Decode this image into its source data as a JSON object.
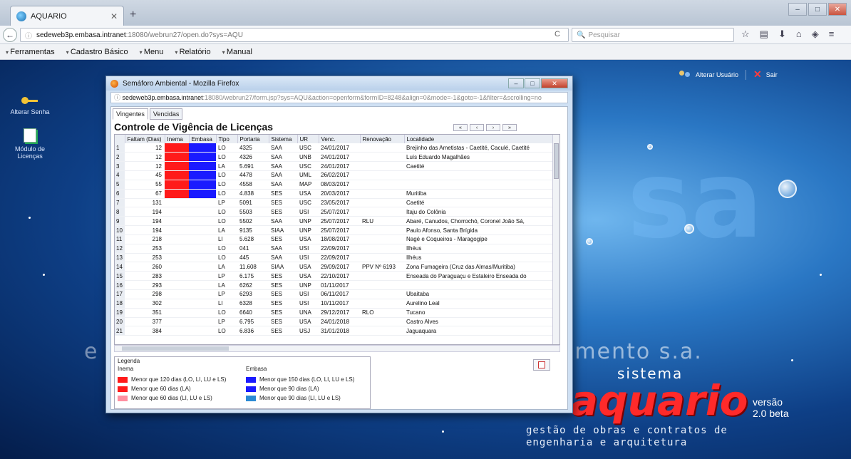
{
  "browser": {
    "tab_title": "AQUARIO",
    "url_host": "sedeweb3p.embasa.intranet",
    "url_rest": ":18080/webrun27/open.do?sys=AQU",
    "search_placeholder": "Pesquisar"
  },
  "menubar": [
    "Ferramentas",
    "Cadastro Básico",
    "Menu",
    "Relatório",
    "Manual"
  ],
  "desktop": {
    "icons": [
      {
        "label": "Alterar Senha",
        "icon": "key-icon"
      },
      {
        "label": "Módulo de Licenças",
        "icon": "document-icon"
      }
    ],
    "user_actions": {
      "change_user": "Alterar Usuário",
      "logout": "Sair"
    },
    "watermark_left": "e",
    "watermark_right": "amento s.a.",
    "brand": {
      "sistema": "sistema",
      "name": "aquario",
      "versao": "versão",
      "version": "2.0 beta",
      "tagline_1": "gestão de obras e contratos de",
      "tagline_2": "engenharia e arquitetura"
    }
  },
  "popup": {
    "window_title": "Semáforo Ambiental - Mozilla Firefox",
    "url_host": "sedeweb3p.embasa.intranet",
    "url_rest": ":18080/webrun27/form.jsp?sys=AQU&action=openform&formID=8248&align=0&mode=-1&goto=-1&filter=&scrolling=no",
    "tabs": [
      "Vingentes",
      "Vencidas"
    ],
    "title": "Controle de Vigência de Licenças",
    "pager": [
      "«",
      "‹",
      "›",
      "»"
    ],
    "columns": [
      "",
      "Faltam (Dias)",
      "Inema",
      "Embasa",
      "Tipo",
      "Portaria",
      "Sistema",
      "UR",
      "Venc.",
      "Renovação",
      "Localidade"
    ],
    "rows": [
      [
        "1",
        "12",
        "",
        "",
        "LO",
        "4325",
        "SAA",
        "USC",
        "24/01/2017",
        "",
        "Brejinho das Ametistas - Caetité, Caculé, Caetité"
      ],
      [
        "2",
        "12",
        "",
        "",
        "LO",
        "4326",
        "SAA",
        "UNB",
        "24/01/2017",
        "",
        "Luís Eduardo Magalhães"
      ],
      [
        "3",
        "12",
        "",
        "",
        "LA",
        "5.691",
        "SAA",
        "USC",
        "24/01/2017",
        "",
        "Caetité"
      ],
      [
        "4",
        "45",
        "",
        "",
        "LO",
        "4478",
        "SAA",
        "UML",
        "26/02/2017",
        "",
        ""
      ],
      [
        "5",
        "55",
        "",
        "",
        "LO",
        "4558",
        "SAA",
        "MAP",
        "08/03/2017",
        "",
        ""
      ],
      [
        "6",
        "67",
        "",
        "",
        "LO",
        "4.838",
        "SES",
        "USA",
        "20/03/2017",
        "",
        "Muritiba"
      ],
      [
        "7",
        "131",
        "",
        "",
        "LP",
        "5091",
        "SES",
        "USC",
        "23/05/2017",
        "",
        "Caetité"
      ],
      [
        "8",
        "194",
        "",
        "",
        "LO",
        "5503",
        "SES",
        "USI",
        "25/07/2017",
        "",
        "Itaju do Colônia"
      ],
      [
        "9",
        "194",
        "",
        "",
        "LO",
        "5502",
        "SAA",
        "UNP",
        "25/07/2017",
        "RLU",
        "Abaré, Canudos, Chorrochó, Coronel João Sá,"
      ],
      [
        "10",
        "194",
        "",
        "",
        "LA",
        "9135",
        "SIAA",
        "UNP",
        "25/07/2017",
        "",
        "Paulo Afonso, Santa Brígida"
      ],
      [
        "11",
        "218",
        "",
        "",
        "LI",
        "5.628",
        "SES",
        "USA",
        "18/08/2017",
        "",
        "Nagé e Coqueiros - Maragogipe"
      ],
      [
        "12",
        "253",
        "",
        "",
        "LO",
        "041",
        "SAA",
        "USI",
        "22/09/2017",
        "",
        "Ilhéus"
      ],
      [
        "13",
        "253",
        "",
        "",
        "LO",
        "445",
        "SAA",
        "USI",
        "22/09/2017",
        "",
        "Ilhéus"
      ],
      [
        "14",
        "260",
        "",
        "",
        "LA",
        "11.608",
        "SIAA",
        "USA",
        "29/09/2017",
        "PPV Nº 6193",
        "Zona Fumageira (Cruz das Almas/Muritiba)"
      ],
      [
        "15",
        "283",
        "",
        "",
        "LP",
        "6.175",
        "SES",
        "USA",
        "22/10/2017",
        "",
        "Enseada do Paraguaçu e Estaleiro Enseada do"
      ],
      [
        "16",
        "293",
        "",
        "",
        "LA",
        "6262",
        "SES",
        "UNP",
        "01/11/2017",
        "",
        ""
      ],
      [
        "17",
        "298",
        "",
        "",
        "LP",
        "6293",
        "SES",
        "USI",
        "06/11/2017",
        "",
        "Ubaitaba"
      ],
      [
        "18",
        "302",
        "",
        "",
        "LI",
        "6328",
        "SES",
        "USI",
        "10/11/2017",
        "",
        "Aurelino Leal"
      ],
      [
        "19",
        "351",
        "",
        "",
        "LO",
        "6640",
        "SES",
        "UNA",
        "29/12/2017",
        "RLO",
        "Tucano"
      ],
      [
        "20",
        "377",
        "",
        "",
        "LP",
        "6.795",
        "SES",
        "USA",
        "24/01/2018",
        "",
        "Castro Alves"
      ],
      [
        "21",
        "384",
        "",
        "",
        "LO",
        "6.836",
        "SES",
        "USJ",
        "31/01/2018",
        "",
        "Jaguaquara"
      ]
    ],
    "status_colors": {
      "inema": "#ff1a1a",
      "embasa": "#1a1aff"
    },
    "legend": {
      "title": "Legenda",
      "inema_title": "Inema",
      "inema_items": [
        {
          "label": "Menor que 120 dias (LO, LI, LU e LS)",
          "color": "#ff1a1a"
        },
        {
          "label": "Menor que 60 dias (LA)",
          "color": "#ff1a1a"
        },
        {
          "label": "Menor que 60 dias (LI, LU e LS)",
          "color": "#ff8fa0"
        }
      ],
      "embasa_title": "Embasa",
      "embasa_items": [
        {
          "label": "Menor que 150 dias (LO, LI, LU e LS)",
          "color": "#1a1aff"
        },
        {
          "label": "Menor que 90 dias (LA)",
          "color": "#1a1aff"
        },
        {
          "label": "Menor que 90 dias (LI, LU e LS)",
          "color": "#2a8ad4"
        }
      ]
    }
  }
}
